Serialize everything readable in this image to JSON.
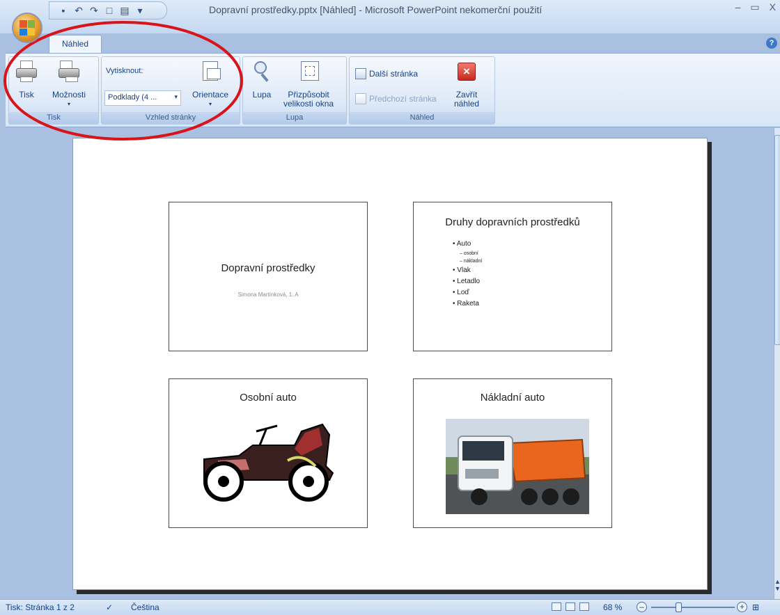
{
  "window": {
    "title": "Dopravní prostředky.pptx [Náhled] - Microsoft PowerPoint nekomerční použití",
    "controls": {
      "minimize": "–",
      "maximize": "▭",
      "close": "X"
    }
  },
  "ribbon": {
    "tab_label": "Náhled",
    "help": "?",
    "groups": {
      "tisk": {
        "label": "Tisk",
        "print_label": "Tisk",
        "options_label": "Možnosti",
        "options_caret": "▾"
      },
      "vzhled": {
        "label": "Vzhled stránky",
        "print_what_label": "Vytisknout:",
        "print_what_value": "Podklady (4 ...",
        "orientation_label": "Orientace",
        "orientation_caret": "▾"
      },
      "lupa": {
        "label": "Lupa",
        "zoom_label": "Lupa",
        "fit_label_1": "Přizpůsobit",
        "fit_label_2": "velikosti okna"
      },
      "nahled": {
        "label": "Náhled",
        "next_page_label": "Další stránka",
        "prev_page_label": "Předchozí stránka",
        "close_label_1": "Zavřít",
        "close_label_2": "náhled"
      }
    }
  },
  "slides": [
    {
      "title": "Dopravní prostředky",
      "subtitle": "Simona Martínková, 1. A"
    },
    {
      "title": "Druhy dopravních prostředků",
      "bullets": [
        "Auto",
        "osobní",
        "nákladní",
        "Vlak",
        "Letadlo",
        "Loď",
        "Raketa"
      ],
      "bullet_marker": "•",
      "sub_marker": "–"
    },
    {
      "title": "Osobní auto"
    },
    {
      "title": "Nákladní auto"
    }
  ],
  "status_bar": {
    "page_info": "Tisk: Stránka 1 z 2",
    "language": "Čeština",
    "zoom": "68 %",
    "zoom_minus": "–",
    "zoom_plus": "+"
  },
  "colors": {
    "annotation": "#d8141a",
    "ribbon_text": "#15428b",
    "close_red": "#e0433b"
  }
}
